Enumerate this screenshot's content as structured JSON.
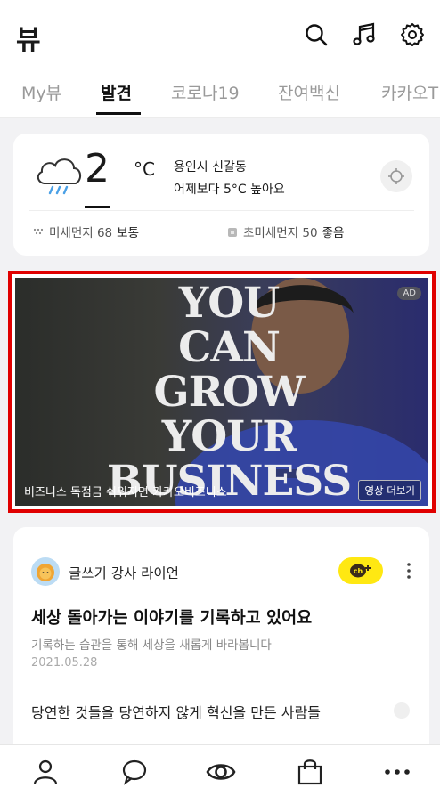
{
  "header": {
    "title": "뷰",
    "icons": [
      "search-icon",
      "music-icon",
      "gear-icon"
    ]
  },
  "tabs": [
    {
      "label": "My뷰",
      "active": false
    },
    {
      "label": "발견",
      "active": true
    },
    {
      "label": "코로나19",
      "active": false
    },
    {
      "label": "잔여백신",
      "active": false
    },
    {
      "label": "카카오T",
      "active": false
    }
  ],
  "weather": {
    "icon": "rain-cloud-icon",
    "temperature": "2",
    "unit": "°C",
    "location": "용인시 신갈동",
    "comparison": "어제보다 5°C 높아요",
    "fine_dust": {
      "label": "미세먼지 68",
      "grade": "보통"
    },
    "ultra_fine_dust": {
      "label": "초미세먼지 50",
      "grade": "좋음"
    }
  },
  "ad": {
    "headline_lines": [
      "YOU",
      "CAN",
      "GROW",
      "YOUR",
      "BUSINESS"
    ],
    "badge": "AD",
    "caption": "비즈니스 독점금 쉬워지면 카카오비즈니스",
    "more_label": "영상 더보기",
    "highlight_color": "#e00000"
  },
  "post": {
    "author": "글쓰기 강사 라이언",
    "title": "세상 돌아가는 이야기를 기록하고 있어요",
    "subtitle": "기록하는 습관을 통해 세상을 새롭게 바라봅니다",
    "date": "2021.05.28",
    "next_title": "당연한 것들을 당연하지 않게 혁신을 만든 사람들",
    "channel_button_color": "#ffe812"
  },
  "bottom_nav": [
    "person-icon",
    "chat-bubble-icon",
    "view-eye-icon",
    "shopping-bag-icon",
    "more-dots-icon"
  ]
}
